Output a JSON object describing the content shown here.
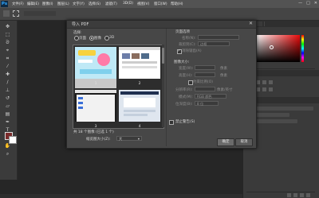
{
  "app": {
    "logo": "Ps"
  },
  "menubar": {
    "items": [
      "文件(F)",
      "编辑(E)",
      "图像(I)",
      "图层(L)",
      "文字(Y)",
      "选择(S)",
      "滤镜(T)",
      "3D(D)",
      "视图(V)",
      "窗口(W)",
      "帮助(H)"
    ]
  },
  "window_controls": {
    "minimize": "—",
    "maximize": "□",
    "close": "✕"
  },
  "dialog": {
    "title": "导入 PDF",
    "close": "✕",
    "select_label": "选择:",
    "select_options": {
      "page": "页面",
      "image": "图像",
      "model": "3D"
    },
    "selected_option": "image",
    "thumbnails": [
      {
        "num": "1"
      },
      {
        "num": "2"
      },
      {
        "num": "3"
      },
      {
        "num": "4"
      }
    ],
    "page_status": "共 18 个图像 (已选 1 个)",
    "thumb_size_label": "缩览图大小(Z):",
    "thumb_size_value": "大",
    "page_options": {
      "title": "页面选项",
      "name_label": "名称(N):",
      "crop_label": "裁剪到(C):",
      "crop_value": "边框",
      "anti_alias": "消除锯齿(A)"
    },
    "image_size": {
      "title": "图像大小:",
      "width_label": "宽度(W):",
      "height_label": "高度(H):",
      "constrain_label": "约束比例(O)",
      "resolution_label": "分辨率(R):",
      "mode_label": "模式(M):",
      "depth_label": "位深度(B):",
      "unit_px": "像素",
      "unit_res": "像素/英寸",
      "mode_value": "RGB 颜色",
      "depth_value": "8 位"
    },
    "suppress_warnings": "禁止警告(S)",
    "ok": "确定",
    "cancel": "取消"
  },
  "colors": {
    "menubar": "#535353",
    "panel": "#3a3a3a",
    "dialog": "#474747",
    "accent_hue": "#e80a0a"
  }
}
